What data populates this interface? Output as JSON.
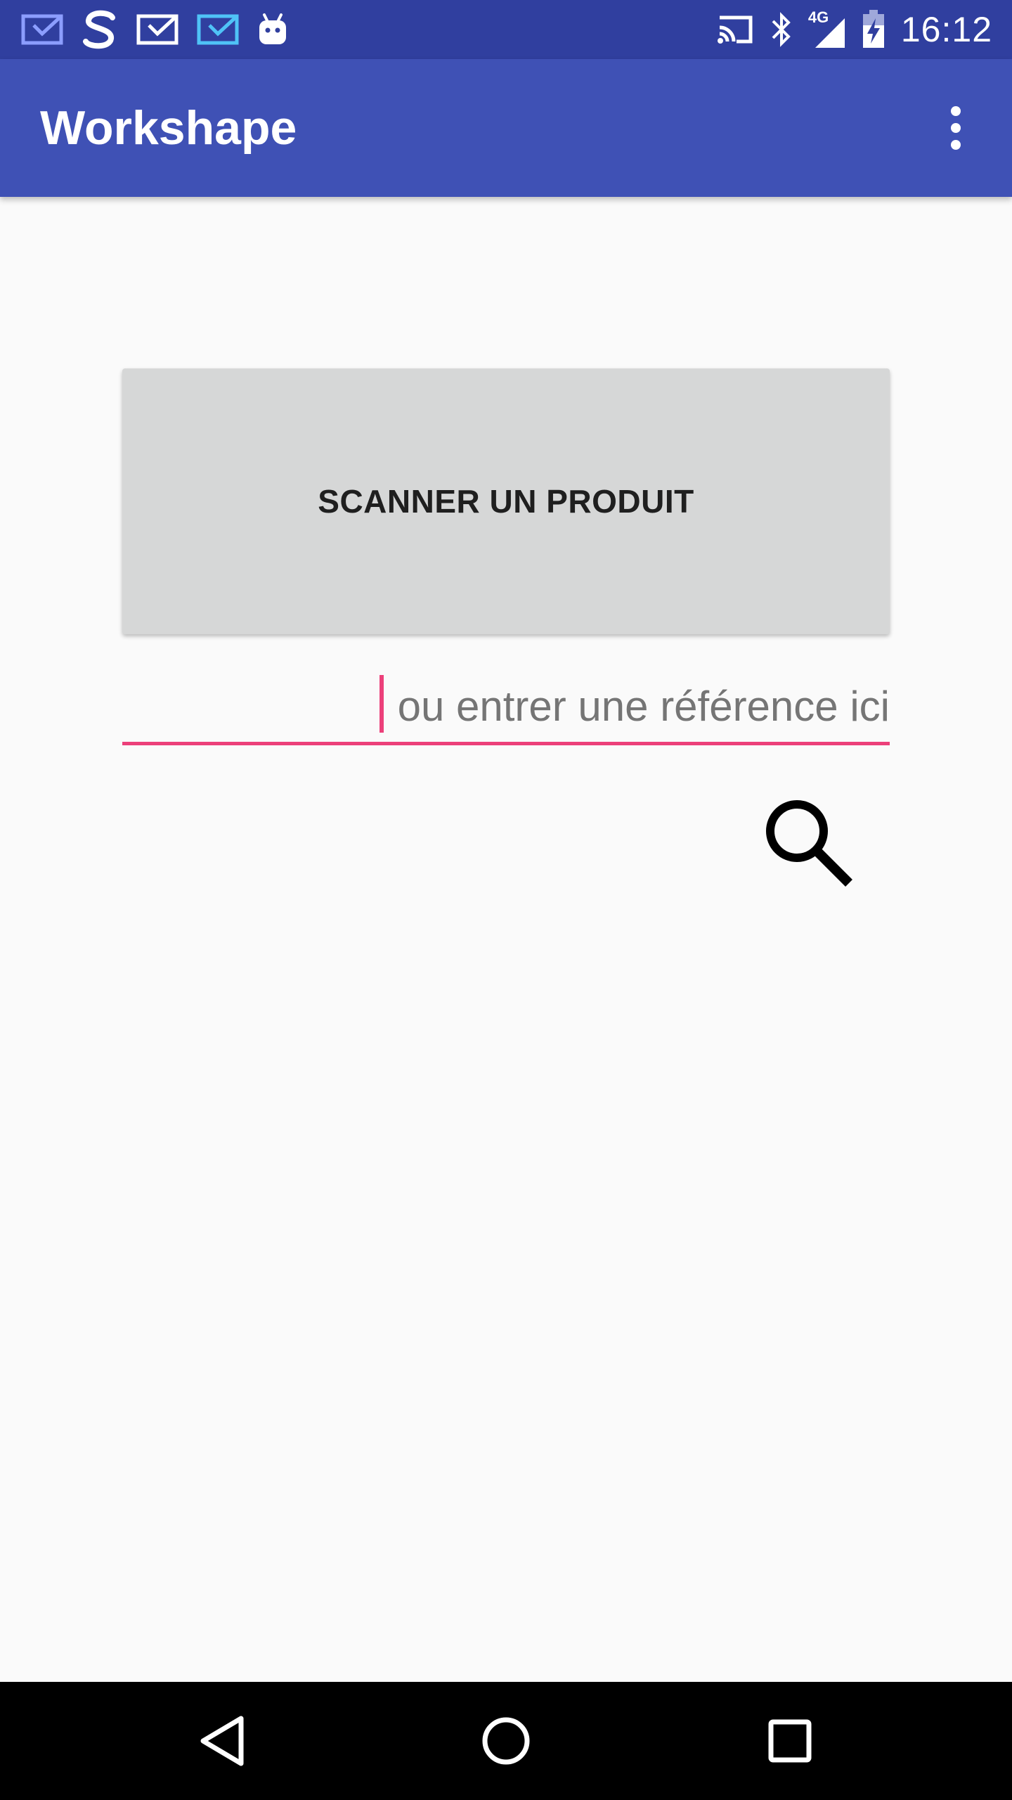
{
  "status_bar": {
    "time": "16:12",
    "network": "4G",
    "left_icons": [
      "mail-icon",
      "s-app-icon",
      "mail-icon",
      "mail-icon",
      "android-icon"
    ],
    "right_icons": [
      "cast-icon",
      "bluetooth-icon",
      "signal-icon",
      "battery-charging-icon"
    ]
  },
  "app_bar": {
    "title": "Workshape",
    "overflow_icon": "more-vert-icon"
  },
  "main": {
    "scan_button_label": "SCANNER UN PRODUIT",
    "reference_input": {
      "placeholder": "ou entrer une référence ici",
      "value": ""
    },
    "search_icon": "search-icon"
  },
  "nav_bar": {
    "icons": [
      "back-icon",
      "home-icon",
      "recents-icon"
    ]
  },
  "colors": {
    "status_bar": "#303f9f",
    "app_bar": "#3f51b5",
    "accent": "#ec407a",
    "background": "#fafafa",
    "button": "#d6d7d7"
  }
}
